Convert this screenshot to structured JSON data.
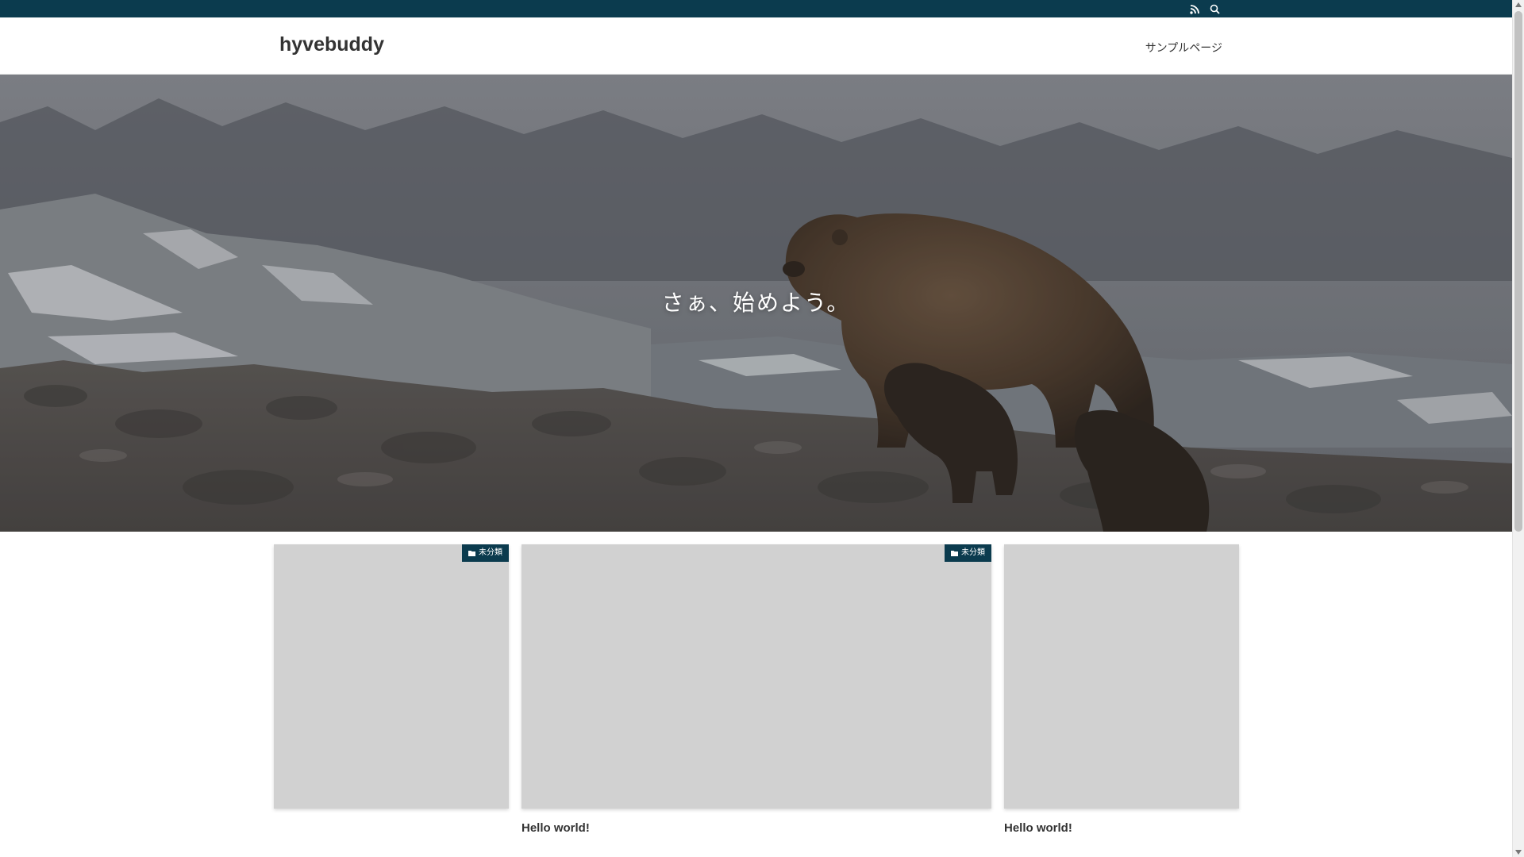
{
  "site": {
    "title": "hyvebuddy"
  },
  "top_bar": {
    "icons": [
      "rss-icon",
      "search-icon"
    ]
  },
  "nav": {
    "items": [
      {
        "label": "サンプルページ"
      }
    ]
  },
  "hero": {
    "caption": "さぁ、始めよう。"
  },
  "cards": [
    {
      "category": "未分類",
      "title": ""
    },
    {
      "category": "未分類",
      "title": "Hello world!"
    },
    {
      "category": "",
      "title": "Hello world!"
    }
  ],
  "colors": {
    "accent": "#0b3b4e",
    "thumb_placeholder": "#d1d1d1",
    "text": "#333333"
  }
}
